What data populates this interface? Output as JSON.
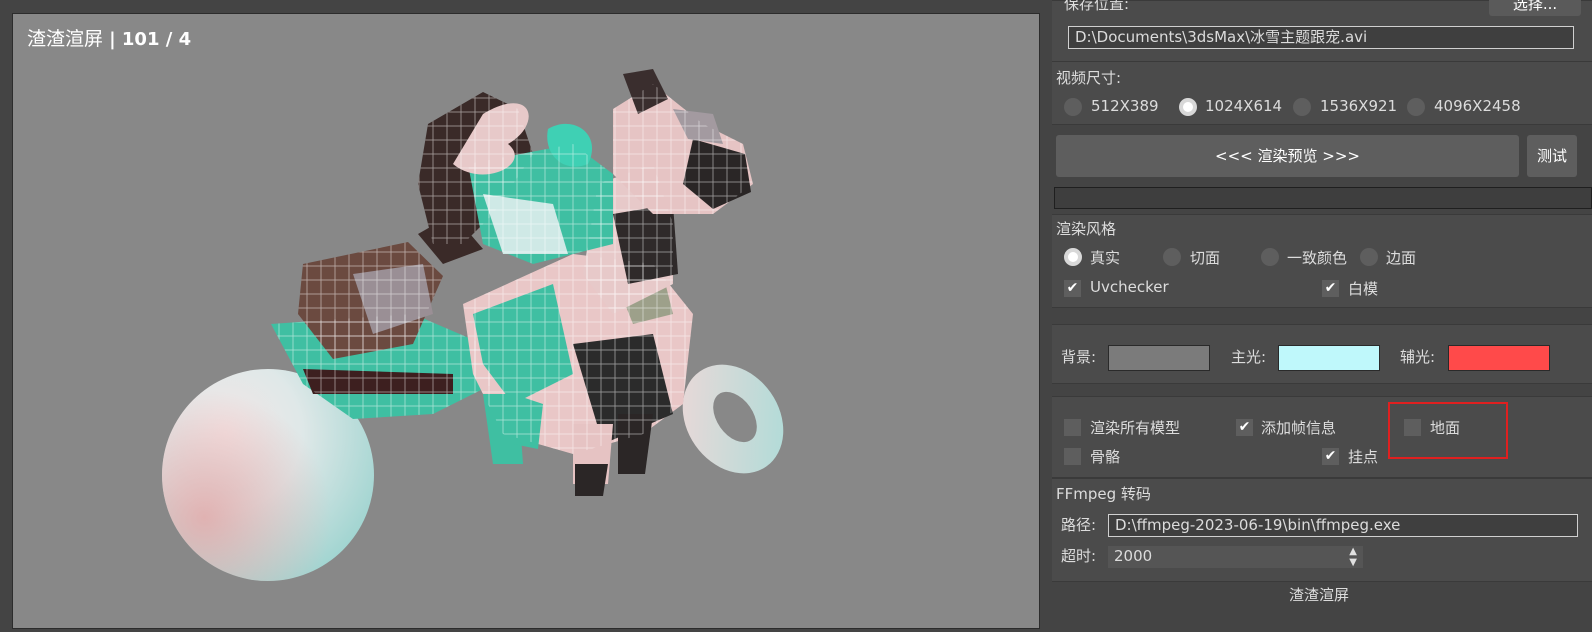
{
  "viewport": {
    "title": "渣渣渲屏",
    "counter": "| 101 / 4"
  },
  "panel": {
    "save_location_label": "保存位置:",
    "choose_button": "选择...",
    "save_path": "D:\\Documents\\3dsMax\\冰雪主题跟宠.avi",
    "video_size_label": "视频尺寸:",
    "video_sizes": [
      {
        "label": "512X389",
        "selected": false
      },
      {
        "label": "1024X614",
        "selected": true
      },
      {
        "label": "1536X921",
        "selected": false
      },
      {
        "label": "4096X2458",
        "selected": false
      }
    ],
    "render_preview_button": "<<<  渲染预览  >>>",
    "test_button": "测试",
    "render_style_label": "渲染风格",
    "styles": [
      {
        "label": "真实",
        "selected": true
      },
      {
        "label": "切面",
        "selected": false
      },
      {
        "label": "一致颜色",
        "selected": false
      },
      {
        "label": "边面",
        "selected": false
      }
    ],
    "uvchecker_label": "Uvchecker",
    "uvchecker_checked": true,
    "white_model_label": "白模",
    "white_model_checked": true,
    "background_label": "背景:",
    "background_color": "#7b7b7b",
    "main_light_label": "主光:",
    "main_light_color": "#bff8fb",
    "fill_light_label": "辅光:",
    "fill_light_color": "#ff4a4a",
    "render_all_label": "渲染所有模型",
    "render_all_checked": false,
    "add_frame_info_label": "添加帧信息",
    "add_frame_info_checked": true,
    "ground_label": "地面",
    "ground_checked": false,
    "skeleton_label": "骨骼",
    "skeleton_checked": false,
    "hang_point_label": "挂点",
    "hang_point_checked": true,
    "ffmpeg_label": "FFmpeg 转码",
    "path_label": "路径:",
    "ffmpeg_path": "D:\\ffmpeg-2023-06-19\\bin\\ffmpeg.exe",
    "timeout_label": "超时:",
    "timeout_value": "2000",
    "footer_button": "渣渣渲屏",
    "highlight_color": "#e02020"
  }
}
